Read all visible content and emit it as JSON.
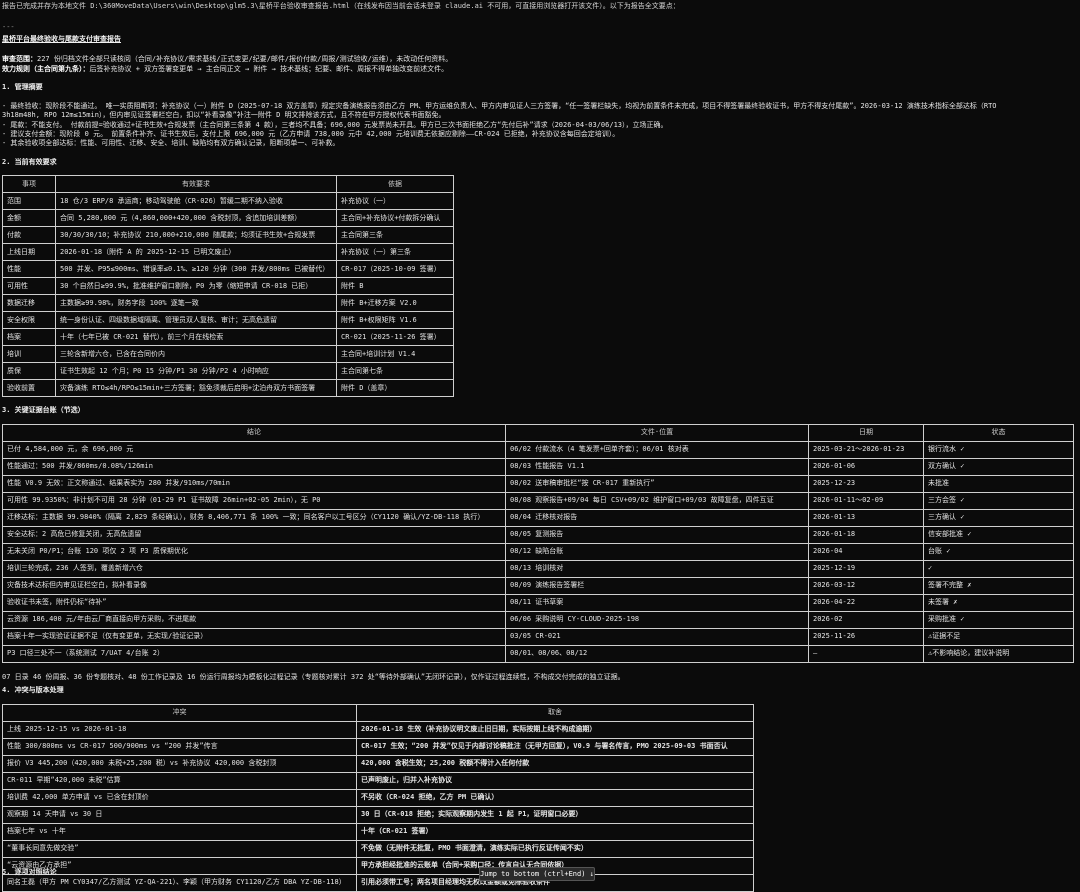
{
  "header": {
    "intro": "报告已完成并存为本地文件 D:\\360MoveData\\Users\\win\\Desktop\\glm5.3\\星桥平台验收审查报告.html（在线发布因当前会话未登录 claude.ai 不可用，可直接用浏览器打开该文件）。以下为报告全文要点：",
    "rule": "---",
    "title": "星桥平台最终验收与尾款支付审查报告",
    "scope_label": "审查范围：",
    "scope_text": "227 份归档文件全部只读核阅（合同/补充协议/需求基线/正式变更/纪要/邮件/报价付款/周报/测试验收/运维），未改动任何资料。",
    "rule_label": "效力规则（主合同第九条）：",
    "rule_text": "后签补充协议 + 双方签署变更单 → 主合同正文 → 附件 → 技术基线；纪要、邮件、周报不得单独改变前述文件。"
  },
  "summary": {
    "heading": "1. 管理摘要",
    "lines": [
      "- 最终验收：现阶段不能通过。 唯一实质阻断项：补充协议（一）附件 D（2025-07-18 双方盖章）规定灾备演练报告须由乙方 PM、甲方运维负责人、甲方内审见证人三方签署，“任一签署栏缺失，均视为前置条件未完成，项目不得签署最终验收证书，甲方不得支付尾款”。2026-03-12 演练技术指标全部达标（RTO",
      "3h18m48h, RPO 12m≤15min），但内审见证签署栏空白，扣以“补看录像”补注一附件 D 明文排除该方式，且不符在甲方授权代表书面豁免。",
      "- 尾款：不能支付。 付款前提=验收通过+证书生效+合规发票（主合同第三条第 4 款），三者均不具备；696,000 元发票尚未开具。甲方已三次书面拒绝乙方“先付后补”请求（2026-04-03/06/13），立场正确。",
      "- 建议支付金额：现阶段 0 元。 前置条件补齐、证书生效后，支付上限 696,000 元（乙方申请 738,000 元中 42,000 元培训费无依据应剔除——CR-024 已拒绝，补充协议含每回会定培训）。",
      "- 其余验收项全部达标：性能、可用性、迁移、安全、培训、缺陷均有双方确认记录，阻断项单一、可补救。"
    ]
  },
  "effective": {
    "heading": "2. 当前有效要求",
    "headers": [
      "事项",
      "有效要求",
      "依据"
    ],
    "rows": [
      [
        "范围",
        "18 仓/3 ERP/8 承运商；移动驾驶舱（CR-026）暂缓二期不纳入验收",
        "补充协议（一）"
      ],
      [
        "金额",
        "合同 5,280,000 元（4,860,000+420,000 含税封顶，含追加培训差额）",
        "主合同+补充协议+付款拆分确认"
      ],
      [
        "付款",
        "30/30/30/10；补充协议 210,000+210,000 随尾款；均须证书生效+合规发票",
        "主合同第三条"
      ],
      [
        "上线日期",
        "2026-01-18（附件 A 的 2025-12-15 已明文废止）",
        "补充协议（一）第三条"
      ],
      [
        "性能",
        "500 并发、P95≤900ms、错误率≤0.1%、≥120 分钟（300 并发/800ms 已被替代）",
        "CR-017（2025-10-09 签署）"
      ],
      [
        "可用性",
        "30 个自然日≥99.9%，批准维护窗口剔除，P0 为零（缩短申请 CR-018 已拒）",
        "附件 B"
      ],
      [
        "数据迁移",
        "主数据≥99.98%，财务字段 100% 逐笔一致",
        "附件 B+迁移方案 V2.0"
      ],
      [
        "安全权限",
        "统一身份认证、四级数据域隔离、管理员双人复核、审计；无高危遗留",
        "附件 B+权限矩阵 V1.6"
      ],
      [
        "档案",
        "十年（七年已被 CR-021 替代），前三个月在线检索",
        "CR-021（2025-11-26 签署）"
      ],
      [
        "培训",
        "三轮含新增六仓，已含在合同价内",
        "主合同+培训计划 V1.4"
      ],
      [
        "质保",
        "证书生效起 12 个月；P0 15 分钟/P1 30 分钟/P2 4 小时响应",
        "主合同第七条"
      ],
      [
        "验收前置",
        "灾备演练 RTO≤4h/RPO≤15min+三方签署；豁免须裁后启明+沈泊舟双方书面签署",
        "附件 D（盖章）"
      ]
    ]
  },
  "evidence": {
    "heading": "3. 关键证据台账（节选）",
    "headers": [
      "结论",
      "文件·位置",
      "日期",
      "状态"
    ],
    "rows": [
      [
        "已付 4,584,000 元，余 696,000 元",
        "06/02 付款流水（4 笔发票+回单齐套）；06/01 核对表",
        "2025-03-21～2026-01-23",
        "银行流水 ✓"
      ],
      [
        "性能通过：500 并发/860ms/0.08%/126min",
        "08/03 性能报告 V1.1",
        "2026-01-06",
        "双方确认 ✓"
      ],
      [
        "性能 V0.9 无效：正文称通过、结果表实为 280 并发/910ms/70min",
        "08/02 送审稿审批栏“按 CR-017 重新执行”",
        "2025-12-23",
        "未批准"
      ],
      [
        "可用性 99.9350%：非计划不可用 28 分钟（01-29 P1 证书故障 26min+02-05 2min），无 P0",
        "08/08 观察报告+09/04 每日 CSV+09/02 维护窗口+09/03 故障复盘，四件互证",
        "2026-01-11～02-09",
        "三方会签 ✓"
      ],
      [
        "迁移达标：主数据 99.9840%（隔离 2,829 条经确认），财务 8,406,771 条 100% 一致；同名客户以工号区分（CY1120 确认/YZ-DB-118 执行）",
        "08/04 迁移核对报告",
        "2026-01-13",
        "三方确认 ✓"
      ],
      [
        "安全达标：2 高危已修复关闭，无高危遗留",
        "08/05 复测报告",
        "2026-01-18",
        "信安部批准 ✓"
      ],
      [
        "无未关闭 P0/P1；台账 120 项仅 2 项 P3 质保期优化",
        "08/12 缺陷台账",
        "2026-04",
        "台账 ✓"
      ],
      [
        "培训三轮完成，236 人签到，覆盖新增六仓",
        "08/13 培训核对",
        "2025-12-19",
        "✓"
      ],
      [
        "灾备技术达标但内审见证栏空白，拟补看录像",
        "08/09 演练报告签署栏",
        "2026-03-12",
        "签署不完整 ✗"
      ],
      [
        "验收证书未签，附件仍标“待补”",
        "08/11 证书草案",
        "2026-04-22",
        "未签署 ✗"
      ],
      [
        "云资源 186,400 元/年由云厂商直接向甲方采购，不进尾款",
        "06/06 采购说明 CY-CLOUD-2025-198",
        "2026-02",
        "采购批准 ✓"
      ],
      [
        "档案十年一实现验证证据不足（仅有变更单，无实现/验证记录）",
        "03/05 CR-021",
        "2025-11-26",
        "⚠证据不足"
      ],
      [
        "P3 口径三处不一（系统测试 7/UAT 4/台账 2）",
        "08/01、08/06、08/12",
        "—",
        "⚠不影响结论，建议补说明"
      ]
    ]
  },
  "note": "07 日录 46 份周报、36 份专题核对、48 份工作记录及 16 份运行周报均为模板化过程记录（专题核对累计 372 处“等待外部确认”无闭环记录），仅作证过程连续性，不构成交付完成的独立证据。",
  "conflict": {
    "heading": "4. 冲突与版本处理",
    "headers": [
      "冲突",
      "取舍"
    ],
    "rows": [
      [
        "上线 2025-12-15 vs 2026-01-18",
        "2026-01-18 生效（补充协议明文废止旧日期，实际按期上线不构成逾期）"
      ],
      [
        "性能 300/800ms vs CR-017 500/900ms vs “200 并发”传言",
        "CR-017 生效；“200 并发”仅见于内部讨论稿批注（无甲方回复），V0.9 与署名传言，PMO 2025-09-03 书面否认"
      ],
      [
        "报价 V3 445,200（420,000 未税+25,200 税）vs 补充协议 420,000 含税封顶",
        "420,000 含税生效；25,200 税额不得计入任何付款"
      ],
      [
        "CR-011 早期“420,000 未税”估算",
        "已声明废止，归并入补充协议"
      ],
      [
        "培训费 42,000 单方申请 vs 已含在封顶价",
        "不另收（CR-024 拒绝，乙方 PM 已确认）"
      ],
      [
        "观察期 14 天申请 vs 30 日",
        "30 日（CR-018 拒绝；实际观察期内发生 1 起 P1，证明窗口必要）"
      ],
      [
        "档案七年 vs 十年",
        "十年（CR-021 签署）"
      ],
      [
        "“董事长同意先做交验”",
        "不免做（无附件无批复，PMO 书面澄清，演练实际已执行反证传闻不实）"
      ],
      [
        "“云资源由乙方承担”",
        "甲方承担经批准的云账单（合同+采购口径；传言自认无合同依据）"
      ],
      [
        "同名王磊（甲方 PM CY0347/乙方测试 YZ-QA-221）、李颖（甲方财务 CY1120/乙方 DBA YZ-DB-118）",
        "引用必须带工号；两名项目经理均无权改金额或免除验收条件"
      ]
    ]
  },
  "footer": {
    "next_heading": "5. 逐项对照结论",
    "jump_label": "Jump to bottom (ctrl+End) ↓"
  }
}
